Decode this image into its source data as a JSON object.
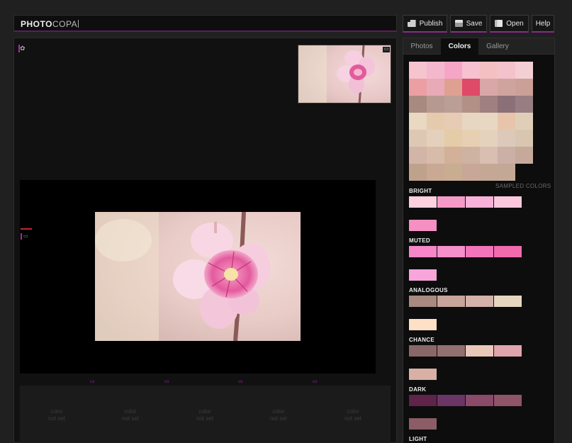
{
  "app": {
    "logo_bold": "PHOTO",
    "logo_thin": "COPA"
  },
  "toolbar": {
    "publish": "Publish",
    "save": "Save",
    "open": "Open",
    "help": "Help"
  },
  "tabs": [
    {
      "label": "Photos"
    },
    {
      "label": "Colors"
    },
    {
      "label": "Gallery"
    }
  ],
  "colors": {
    "grid": [
      [
        "#f6c4cf",
        "#f4b8ce",
        "#f5a6c7",
        "#f6c1d1",
        "#f5c0c1",
        "#f3c2ca",
        "#f3cfd5"
      ],
      [
        "#ec9fa2",
        "#e8aab6",
        "#dea091",
        "#de4a68",
        "#d9a7a8",
        "#cfa49f",
        "#caa097"
      ],
      [
        "#a98a80",
        "#b69a92",
        "#bb9f96",
        "#b39085",
        "#a08080",
        "#8c7078",
        "#987e82"
      ],
      [
        "#e9d8c2",
        "#e5cbac",
        "#e8cbb5",
        "#e7d6c2",
        "#e8d8c3",
        "#e8c5aa",
        "#dfcfb9"
      ],
      [
        "#ddc9b3",
        "#e4d0bc",
        "#e5cca8",
        "#e6d0b1",
        "#e4d2bd",
        "#dcc9b9",
        "#d8c6b0"
      ],
      [
        "#d2b5a8",
        "#d6bca9",
        "#d3b09a",
        "#ceb3a3",
        "#d8bfb2",
        "#cab0a6",
        "#c7a99b"
      ],
      [
        "#bfa28c",
        "#c9a894",
        "#c8ad91",
        "#c9a796",
        "#c4a794",
        "#c4a896"
      ]
    ],
    "sampled_label": "SAMPLED COLORS",
    "sections": [
      {
        "label": "BRIGHT",
        "swatches": [
          "#fdd0df",
          "#f59ac7",
          "#f8b2d9",
          "#fbc8dd"
        ],
        "base": "#f590c2"
      },
      {
        "label": "MUTED",
        "swatches": [
          "#f787c8",
          "#f590cb",
          "#f274bb",
          "#f26aae"
        ],
        "base": "#f8a5dc"
      },
      {
        "label": "ANALOGOUS",
        "swatches": [
          "#a98a80",
          "#c7a59a",
          "#d4b1a9",
          "#e5d7bf"
        ],
        "base": "#fde0c6"
      },
      {
        "label": "CHANCE",
        "swatches": [
          "#8a6868",
          "#937070",
          "#e8c8b8",
          "#dfa4ac"
        ],
        "base": "#d8b0a6"
      },
      {
        "label": "DARK",
        "swatches": [
          "#5e2449",
          "#6b3566",
          "#8a4a6a",
          "#8e5468"
        ],
        "base": "#8c5d66"
      },
      {
        "label": "LIGHT",
        "swatches": [],
        "base": ""
      }
    ]
  },
  "slots": [
    {
      "line1": "color",
      "line2": "not set"
    },
    {
      "line1": "color",
      "line2": "not set"
    },
    {
      "line1": "color",
      "line2": "not set"
    },
    {
      "line1": "color",
      "line2": "not set"
    },
    {
      "line1": "color",
      "line2": "not set"
    }
  ]
}
